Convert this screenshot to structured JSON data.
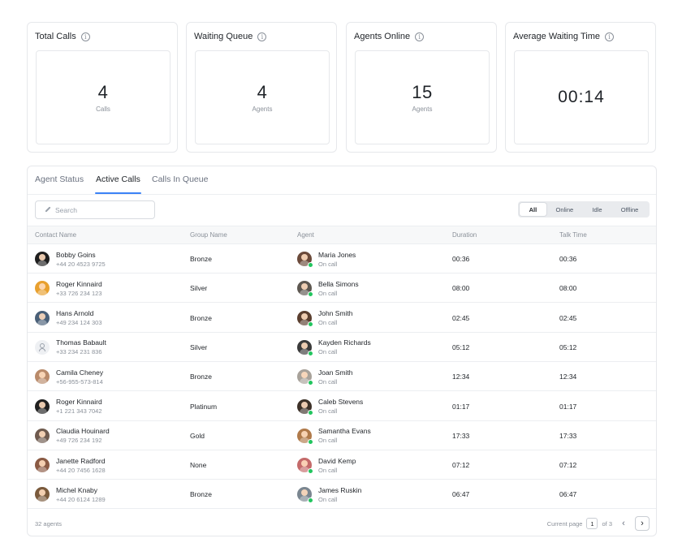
{
  "stats": [
    {
      "title": "Total Calls",
      "value": "4",
      "sub": "Calls"
    },
    {
      "title": "Waiting Queue",
      "value": "4",
      "sub": "Agents"
    },
    {
      "title": "Agents Online",
      "value": "15",
      "sub": "Agents"
    },
    {
      "title": "Average Waiting Time",
      "value": "00:14",
      "sub": ""
    }
  ],
  "tabs": [
    "Agent Status",
    "Active Calls",
    "Calls In Queue"
  ],
  "search": {
    "placeholder": "Search",
    "value": ""
  },
  "filters": [
    "All",
    "Online",
    "Idle",
    "Offline"
  ],
  "columns": [
    "Contact Name",
    "Group Name",
    "Agent",
    "Duration",
    "Talk Time"
  ],
  "rows": [
    {
      "contact": "Bobby Goins",
      "phone": "+44 20 4523 9725",
      "group": "Bronze",
      "agent": "Maria Jones",
      "agent_status": "On call",
      "duration": "00:36",
      "talk_time": "00:36",
      "contact_avatar_color": "#1f1f1f",
      "agent_avatar_color": "#6b4a3a"
    },
    {
      "contact": "Roger Kinnaird",
      "phone": "+33 726 234 123",
      "group": "Silver",
      "agent": "Bella Simons",
      "agent_status": "On call",
      "duration": "08:00",
      "talk_time": "08:00",
      "contact_avatar_color": "#e8a02e",
      "agent_avatar_color": "#5d5750"
    },
    {
      "contact": "Hans Arnold",
      "phone": "+49 234 124 303",
      "group": "Bronze",
      "agent": "John Smith",
      "agent_status": "On call",
      "duration": "02:45",
      "talk_time": "02:45",
      "contact_avatar_color": "#4a6078",
      "agent_avatar_color": "#5a3e2e"
    },
    {
      "contact": "Thomas Babault",
      "phone": "+33 234 231 836",
      "group": "Silver",
      "agent": "Kayden Richards",
      "agent_status": "On call",
      "duration": "05:12",
      "talk_time": "05:12",
      "contact_avatar_color": "",
      "agent_avatar_color": "#3a3a3a"
    },
    {
      "contact": "Camila Cheney",
      "phone": "+56-955-573-814",
      "group": "Bronze",
      "agent": "Joan Smith",
      "agent_status": "On call",
      "duration": "12:34",
      "talk_time": "12:34",
      "contact_avatar_color": "#b98a6a",
      "agent_avatar_color": "#a8a29a"
    },
    {
      "contact": "Roger Kinnaird",
      "phone": "+1 221 343 7042",
      "group": "Platinum",
      "agent": "Caleb Stevens",
      "agent_status": "On call",
      "duration": "01:17",
      "talk_time": "01:17",
      "contact_avatar_color": "#202020",
      "agent_avatar_color": "#3d3128"
    },
    {
      "contact": "Claudia Houinard",
      "phone": "+49 726 234 192",
      "group": "Gold",
      "agent": "Samantha Evans",
      "agent_status": "On call",
      "duration": "17:33",
      "talk_time": "17:33",
      "contact_avatar_color": "#6e5a4e",
      "agent_avatar_color": "#b07a4a"
    },
    {
      "contact": "Janette Radford",
      "phone": "+44 20 7456 1628",
      "group": "None",
      "agent": "David Kemp",
      "agent_status": "On call",
      "duration": "07:12",
      "talk_time": "07:12",
      "contact_avatar_color": "#8a5a44",
      "agent_avatar_color": "#c46a6a"
    },
    {
      "contact": "Michel Knaby",
      "phone": "+44 20 6124 1289",
      "group": "Bronze",
      "agent": "James Ruskin",
      "agent_status": "On call",
      "duration": "06:47",
      "talk_time": "06:47",
      "contact_avatar_color": "#7a5a3c",
      "agent_avatar_color": "#7a8690"
    }
  ],
  "footer": {
    "count_label": "32 agents",
    "page_label": "Current page",
    "current_page": "1",
    "of_label": "of 3"
  },
  "colors": {
    "accent": "#3b82f6",
    "online": "#22c55e"
  }
}
